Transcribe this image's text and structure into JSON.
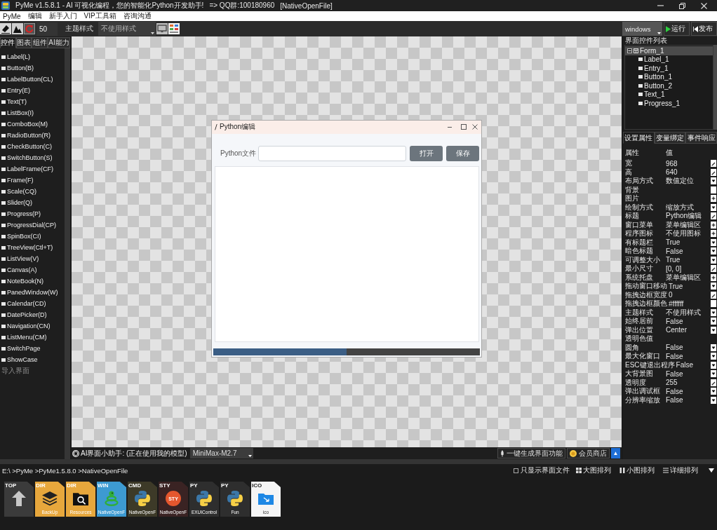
{
  "window": {
    "title": "PyMe v1.5.8.1 - AI 可视化编程，您的智能化Python开发助手!",
    "group": "=> QQ群:100180960",
    "file": "[NativeOpenFile]"
  },
  "menu": [
    "PyMe",
    "编辑",
    "新手入门",
    "VIP工具箱",
    "咨询沟通"
  ],
  "toolbar": {
    "zoom": "50",
    "theme_label": "主题样式",
    "theme": "不使用样式",
    "platform": "windows",
    "run": "运行",
    "publish": "发布"
  },
  "sidebar": {
    "tabs": [
      {
        "label": "控件",
        "selected": true
      },
      {
        "label": "图表",
        "selected": false
      },
      {
        "label": "组件",
        "selected": false
      },
      {
        "label": "AI能力",
        "selected": false
      }
    ],
    "items": [
      "Label(L)",
      "Button(B)",
      "LabelButton(CL)",
      "Entry(E)",
      "Text(T)",
      "ListBox(I)",
      "ComboBox(M)",
      "RadioButton(R)",
      "CheckButton(C)",
      "SwitchButton(S)",
      "LabelFrame(CF)",
      "Frame(F)",
      "Scale(CQ)",
      "Slider(Q)",
      "Progress(P)",
      "ProgressDial(CP)",
      "SpinBox(CI)",
      "TreeView(Ctl+T)",
      "ListView(V)",
      "Canvas(A)",
      "NoteBook(N)",
      "PanedWindow(W)",
      "Calendar(CD)",
      "DatePicker(D)",
      "Navigation(CN)",
      "ListMenu(CM)",
      "SwitchPage",
      "ShowCase"
    ],
    "import": "导入界面"
  },
  "canvas": {
    "dialog": {
      "title": "Python编辑",
      "file_label": "Python文件",
      "open_button": "打开",
      "save_button": "保存",
      "progress": {
        "level": 0.5
      }
    }
  },
  "ai_bar": {
    "label": "AI界面小助手: (正在使用我的模型)",
    "model": "MiniMax-M2.7",
    "generate": "一键生成界面功能",
    "shop": "会员商店",
    "toggle": "▲"
  },
  "right_panel": {
    "title": "界面控件列表",
    "tree": [
      {
        "label": "Form_1",
        "selected": true,
        "expanded": true,
        "children": [
          {
            "label": "Label_1",
            "selected": false
          },
          {
            "label": "Entry_1",
            "selected": false
          },
          {
            "label": "Button_1",
            "selected": false
          },
          {
            "label": "Button_2",
            "selected": false
          },
          {
            "label": "Text_1",
            "selected": false
          },
          {
            "label": "Progress_1",
            "selected": false
          }
        ]
      }
    ],
    "tabs": [
      {
        "label": "设置属性",
        "selected": true
      },
      {
        "label": "变量绑定",
        "selected": false
      },
      {
        "label": "事件响应",
        "selected": false
      }
    ],
    "columns": [
      "属性",
      "值"
    ],
    "properties": [
      {
        "name": "宽",
        "value": "968",
        "kind": "edit"
      },
      {
        "name": "高",
        "value": "640",
        "kind": "edit"
      },
      {
        "name": "布局方式",
        "value": "数值定位",
        "kind": "dropdown"
      },
      {
        "name": "背景",
        "kind": "swatch"
      },
      {
        "name": "图片",
        "kind": "add"
      },
      {
        "name": "绘制方式",
        "value": "缩放方式",
        "kind": "dropdown"
      },
      {
        "name": "标题",
        "value": "Python编辑",
        "kind": "edit"
      },
      {
        "name": "窗口菜单",
        "value": "菜单编辑区",
        "kind": "add"
      },
      {
        "name": "程序图标",
        "value": "不使用图标",
        "kind": "add"
      },
      {
        "name": "有标题栏",
        "value": "True",
        "kind": "dropdown"
      },
      {
        "name": "暗色标题",
        "value": "False",
        "kind": "dropdown"
      },
      {
        "name": "可调整大小",
        "value": "True",
        "kind": "dropdown"
      },
      {
        "name": "最小尺寸",
        "value": "[0, 0]",
        "kind": "edit"
      },
      {
        "name": "系统托盘",
        "value": "菜单编辑区",
        "kind": "add"
      },
      {
        "name": "拖动窗口移动",
        "value": "True",
        "kind": "dropdown"
      },
      {
        "name": "拖拽边框宽度",
        "value": "0",
        "kind": "edit"
      },
      {
        "name": "拖拽边框颜色",
        "value": "#ffffff",
        "kind": "swatch"
      },
      {
        "name": "主题样式",
        "value": "不使用样式",
        "kind": "dropdown"
      },
      {
        "name": "始终居前",
        "value": "False",
        "kind": "dropdown"
      },
      {
        "name": "弹出位置",
        "value": "Center",
        "kind": "dropdown"
      },
      {
        "name": "透明色值",
        "kind": "none"
      },
      {
        "name": "圆角",
        "value": "False",
        "kind": "dropdown"
      },
      {
        "name": "最大化窗口",
        "value": "False",
        "kind": "dropdown"
      },
      {
        "name": "ESC键退出程序",
        "value": "False",
        "kind": "dropdown"
      },
      {
        "name": "大背景图",
        "value": "False",
        "kind": "dropdown"
      },
      {
        "name": "透明度",
        "value": "255",
        "kind": "edit"
      },
      {
        "name": "弹出调试框",
        "value": "False",
        "kind": "dropdown"
      },
      {
        "name": "分辨率缩放",
        "value": "False",
        "kind": "dropdown"
      }
    ]
  },
  "explorer": {
    "path": "E:\\ >PyMe >PyMe1.5.8.0 >NativeOpenFile",
    "filter": {
      "label": "只显示界面文件",
      "checked": false
    },
    "views": [
      {
        "label": "大图排列",
        "kind": "grid"
      },
      {
        "label": "小图排列",
        "kind": "bars"
      },
      {
        "label": "详细排列",
        "kind": "list"
      }
    ],
    "files": [
      {
        "kind": "up",
        "type": "TOP"
      },
      {
        "kind": "layers",
        "type": "DIR",
        "name": "BackUp"
      },
      {
        "kind": "search-folder",
        "type": "DIR",
        "name": "Resources"
      },
      {
        "kind": "snake",
        "type": "WIN",
        "name": "NativeOpenF"
      },
      {
        "kind": "cmd",
        "type": "CMD",
        "name": "NativeOpenF"
      },
      {
        "kind": "style",
        "type": "STY",
        "name": "NativeOpenF",
        "logo": "STY"
      },
      {
        "kind": "py",
        "type": "PY",
        "name": "EXUIControl"
      },
      {
        "kind": "py",
        "type": "PY",
        "name": "Fun"
      },
      {
        "kind": "ico",
        "type": "ICO",
        "name": "ico"
      }
    ]
  }
}
